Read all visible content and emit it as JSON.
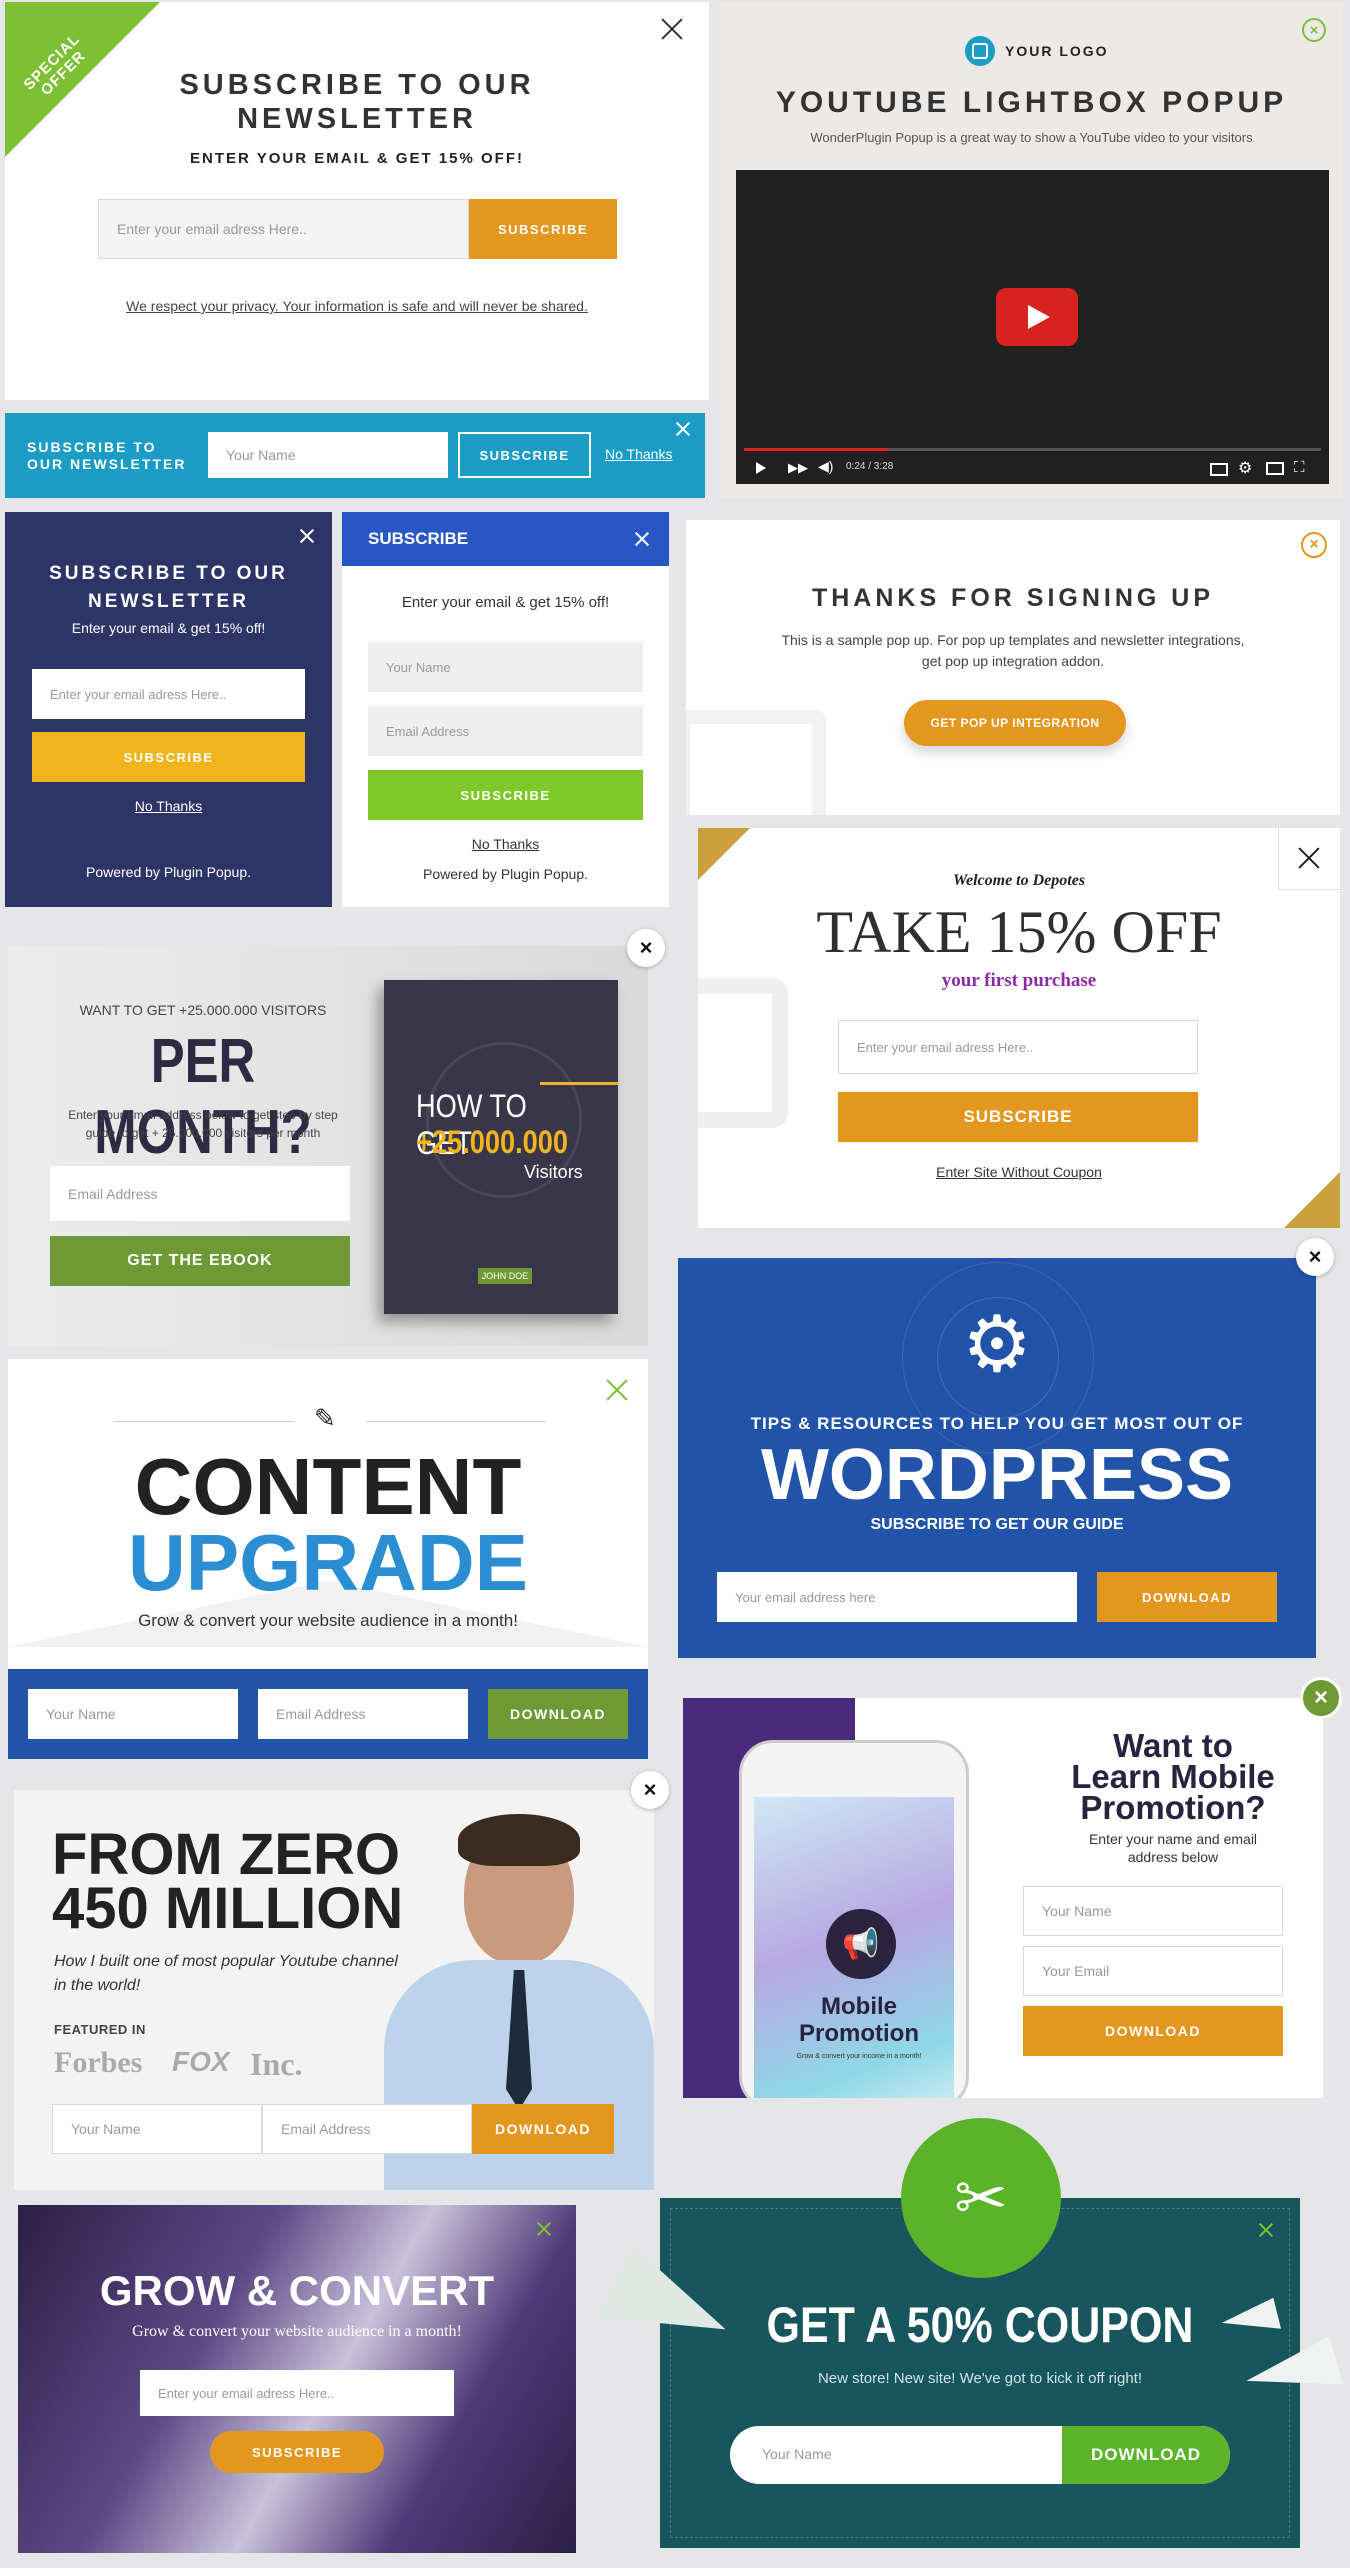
{
  "colors": {
    "orange": "#e4971f",
    "green": "#7ec033",
    "navy": "#2d3567",
    "blue": "#1f5aa8",
    "teal": "#1a9cc4",
    "yellow": "#f0b41c"
  },
  "p1": {
    "ribbon": "SPECIAL OFFER",
    "title_line1": "SUBSCRIBE TO OUR",
    "title_line2": "NEWSLETTER",
    "subtitle": "ENTER YOUR EMAIL & GET 15% OFF!",
    "placeholder": "Enter your email adress Here..",
    "button": "SUBSCRIBE",
    "privacy": "We respect your privacy. Your information is safe and will never be shared."
  },
  "p2": {
    "logo": "YOUR LOGO",
    "title": "YOUTUBE LIGHTBOX POPUP",
    "subtitle": "WonderPlugin Popup is a great way to show a YouTube video to your visitors",
    "time": "0:24 / 3:28"
  },
  "p3": {
    "label_line1": "SUBSCRIBE TO",
    "label_line2": "OUR NEWSLETTER",
    "placeholder": "Your Name",
    "button": "SUBSCRIBE",
    "no_thanks": "No Thanks"
  },
  "p4": {
    "title_line1": "SUBSCRIBE TO OUR",
    "title_line2": "NEWSLETTER",
    "subtitle": "Enter your email & get 15% off!",
    "placeholder": "Enter your email adress Here..",
    "button": "SUBSCRIBE",
    "no_thanks": "No Thanks",
    "powered": "Powered by Plugin Popup."
  },
  "p5": {
    "header": "SUBSCRIBE",
    "subtitle": "Enter your email & get 15% off!",
    "name_ph": "Your Name",
    "email_ph": "Email Address",
    "button": "SUBSCRIBE",
    "no_thanks": "No Thanks",
    "powered": "Powered by Plugin Popup."
  },
  "p6": {
    "title": "THANKS FOR SIGNING UP",
    "text_line1": "This is a sample pop up.  For pop up templates and newsletter integrations,",
    "text_line2": "get pop up integration addon.",
    "button": "GET POP UP INTEGRATION"
  },
  "p7": {
    "kicker": "WANT TO GET +25.000.000 VISITORS",
    "title": "PER MONTH?",
    "text_line1": "Enter your email address below to get step by step",
    "text_line2": "guide to get + 25.000.000 visitors per month",
    "placeholder": "Email Address",
    "button": "GET THE EBOOK",
    "book_line1": "HOW TO GET",
    "book_line2": "+25.000.000",
    "book_line3": "Visitors",
    "book_author": "JOHN DOE"
  },
  "p8": {
    "kicker": "Welcome to Depotes",
    "title": "TAKE 15% OFF",
    "subtitle": "your first purchase",
    "placeholder": "Enter your email adress Here..",
    "button": "SUBSCRIBE",
    "link": "Enter Site Without Coupon"
  },
  "p9": {
    "kicker": "TIPS & RESOURCES TO HELP YOU GET MOST OUT OF",
    "title": "WORDPRESS",
    "subtitle": "SUBSCRIBE TO GET OUR GUIDE",
    "placeholder": "Your email address here",
    "button": "DOWNLOAD"
  },
  "p10": {
    "title_line1": "CONTENT",
    "title_line2": "UPGRADE",
    "subtitle": "Grow & convert your website audience in a month!",
    "name_ph": "Your Name",
    "email_ph": "Email Address",
    "button": "DOWNLOAD"
  },
  "p11": {
    "title_line1": "Want to",
    "title_line2": "Learn Mobile",
    "title_line3": "Promotion?",
    "text_line1": "Enter your name and email",
    "text_line2": "address below",
    "name_ph": "Your Name",
    "email_ph": "Your Email",
    "button": "DOWNLOAD",
    "phone_title_line1": "Mobile",
    "phone_title_line2": "Promotion",
    "phone_text": "Grow & convert your income in a month!"
  },
  "p12": {
    "title_line1": "FROM ZERO",
    "title_line2": "450 MILLION",
    "text_line1": "How I built one of most popular Youtube channel",
    "text_line2": "in the world!",
    "featured": "FEATURED IN",
    "logo1": "Forbes",
    "logo2": "FOX",
    "logo3": "Inc.",
    "name_ph": "Your Name",
    "email_ph": "Email Address",
    "button": "DOWNLOAD"
  },
  "p13": {
    "title": "GROW & CONVERT",
    "subtitle": "Grow & convert your website audience in a month!",
    "placeholder": "Enter your email adress Here..",
    "button": "SUBSCRIBE"
  },
  "p14": {
    "title": "GET A 50% COUPON",
    "subtitle": "New store! New site! We've got to kick it off right!",
    "placeholder": "Your Name",
    "button": "DOWNLOAD"
  }
}
